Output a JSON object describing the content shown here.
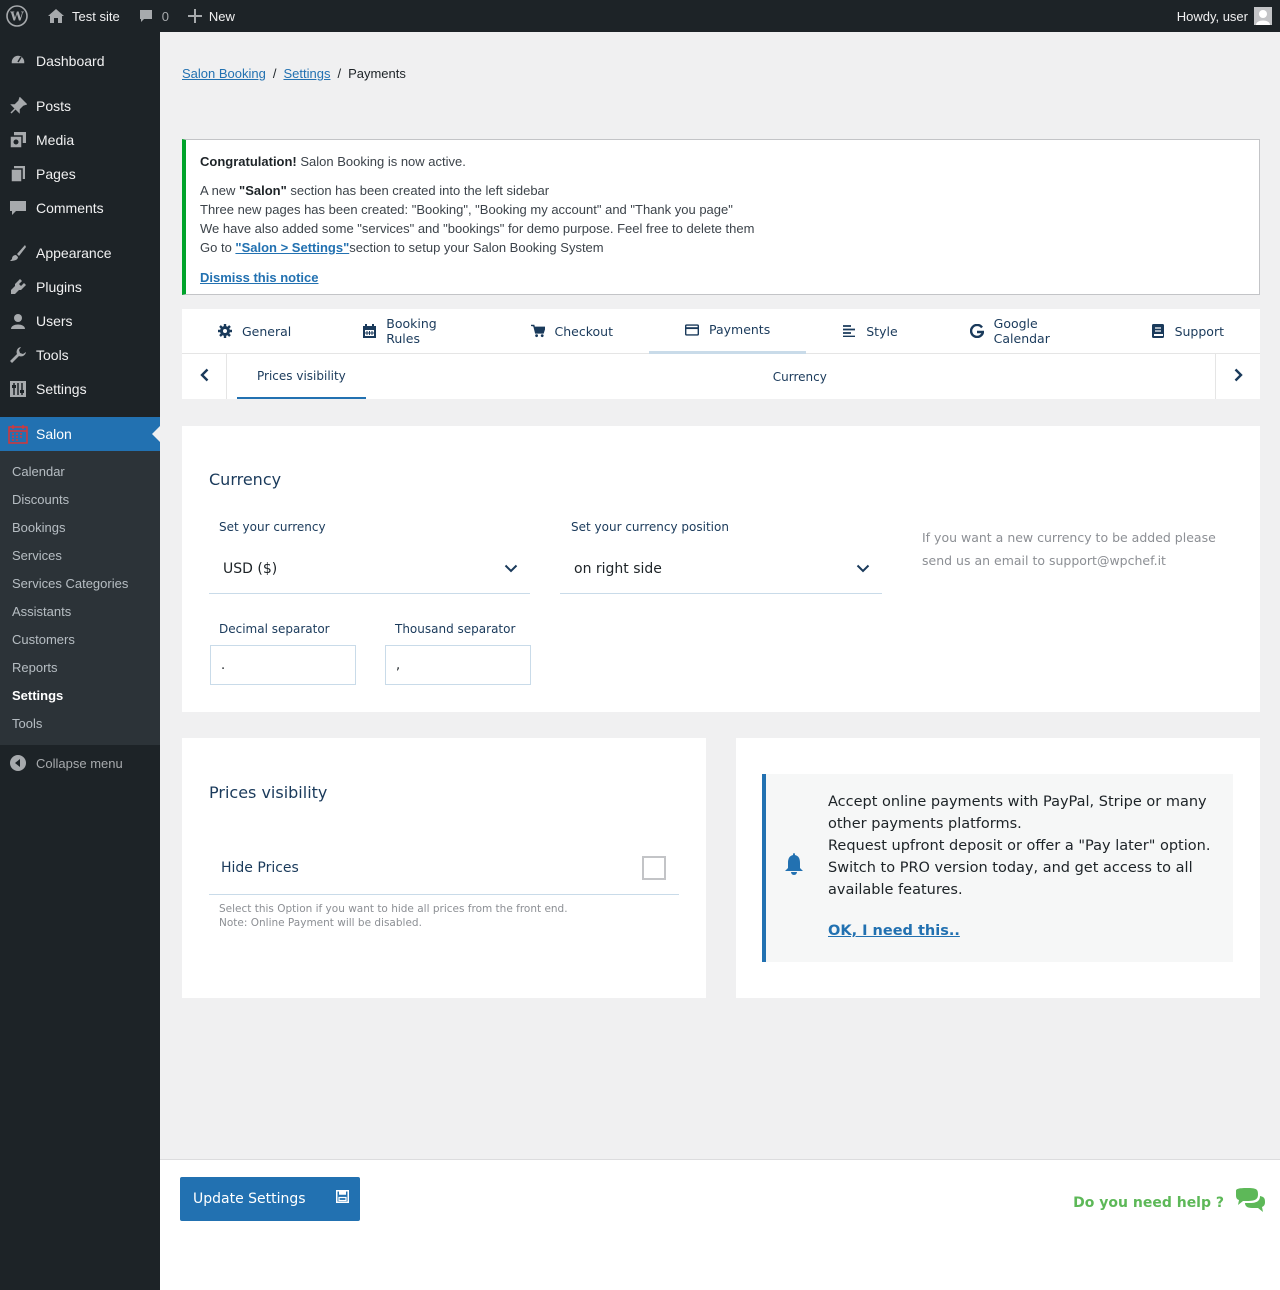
{
  "adminbar": {
    "site_name": "Test site",
    "comments_count": "0",
    "new_label": "New",
    "howdy": "Howdy, user"
  },
  "sidebar": {
    "items": [
      {
        "label": "Dashboard",
        "icon": "dashboard-icon"
      },
      {
        "label": "Posts",
        "icon": "pin-icon"
      },
      {
        "label": "Media",
        "icon": "media-icon"
      },
      {
        "label": "Pages",
        "icon": "pages-icon"
      },
      {
        "label": "Comments",
        "icon": "comment-icon"
      },
      {
        "label": "Appearance",
        "icon": "brush-icon"
      },
      {
        "label": "Plugins",
        "icon": "plugin-icon"
      },
      {
        "label": "Users",
        "icon": "user-icon"
      },
      {
        "label": "Tools",
        "icon": "wrench-icon"
      },
      {
        "label": "Settings",
        "icon": "settings-icon"
      },
      {
        "label": "Salon",
        "icon": "calendar-icon"
      }
    ],
    "submenu": [
      "Calendar",
      "Discounts",
      "Bookings",
      "Services",
      "Services Categories",
      "Assistants",
      "Customers",
      "Reports",
      "Settings",
      "Tools"
    ],
    "active_submenu": "Settings",
    "collapse_label": "Collapse menu"
  },
  "breadcrumb": {
    "root": "Salon Booking",
    "sep": "/",
    "settings": "Settings",
    "current": "Payments"
  },
  "notice": {
    "congrats_bold": "Congratulation!",
    "congrats_rest": " Salon Booking is now active.",
    "line1_pre": "A new ",
    "line1_bold": "\"Salon\"",
    "line1_post": " section has been created into the left sidebar",
    "line2": "Three new pages has been created: \"Booking\", \"Booking my account\" and \"Thank you page\"",
    "line3": "We have also added some \"services\" and \"bookings\" for demo purpose. Feel free to delete them",
    "line4_pre": "Go to ",
    "line4_link": "\"Salon > Settings\"",
    "line4_post": "section to setup your Salon Booking System",
    "dismiss": "Dismiss this notice"
  },
  "tabs": [
    {
      "label": "General",
      "icon": "gear-icon"
    },
    {
      "label": "Booking Rules",
      "icon": "calendar-icon"
    },
    {
      "label": "Checkout",
      "icon": "cart-icon"
    },
    {
      "label": "Payments",
      "icon": "credit-card-icon"
    },
    {
      "label": "Style",
      "icon": "align-left-icon"
    },
    {
      "label": "Google Calendar",
      "icon": "google-icon"
    },
    {
      "label": "Support",
      "icon": "book-icon"
    }
  ],
  "active_tab": "Payments",
  "subtabs": {
    "active": "Prices visibility",
    "other": "Currency"
  },
  "currency": {
    "title": "Currency",
    "currency_label": "Set your currency",
    "currency_value": "USD ($)",
    "position_label": "Set your currency position",
    "position_value": "on right side",
    "hint_line1": "If you want a new currency to be added please",
    "hint_line2": "send us an email to support@wpchef.it",
    "decimal_label": "Decimal separator",
    "decimal_value": ".",
    "thousand_label": "Thousand separator",
    "thousand_value": ","
  },
  "prices": {
    "title": "Prices visibility",
    "hide_label": "Hide Prices",
    "hide_checked": false,
    "help_line1": "Select this Option if you want to hide all prices from the front end.",
    "help_line2": "Note: Online Payment will be disabled."
  },
  "promo": {
    "line1": "Accept online payments with PayPal, Stripe or many other payments platforms.",
    "line2": "Request upfront deposit or offer a \"Pay later\" option. Switch to PRO version today, and get access to all available features.",
    "link": "OK, I need this.."
  },
  "footer": {
    "update_button": "Update Settings",
    "help_text": "Do you need help ?"
  }
}
